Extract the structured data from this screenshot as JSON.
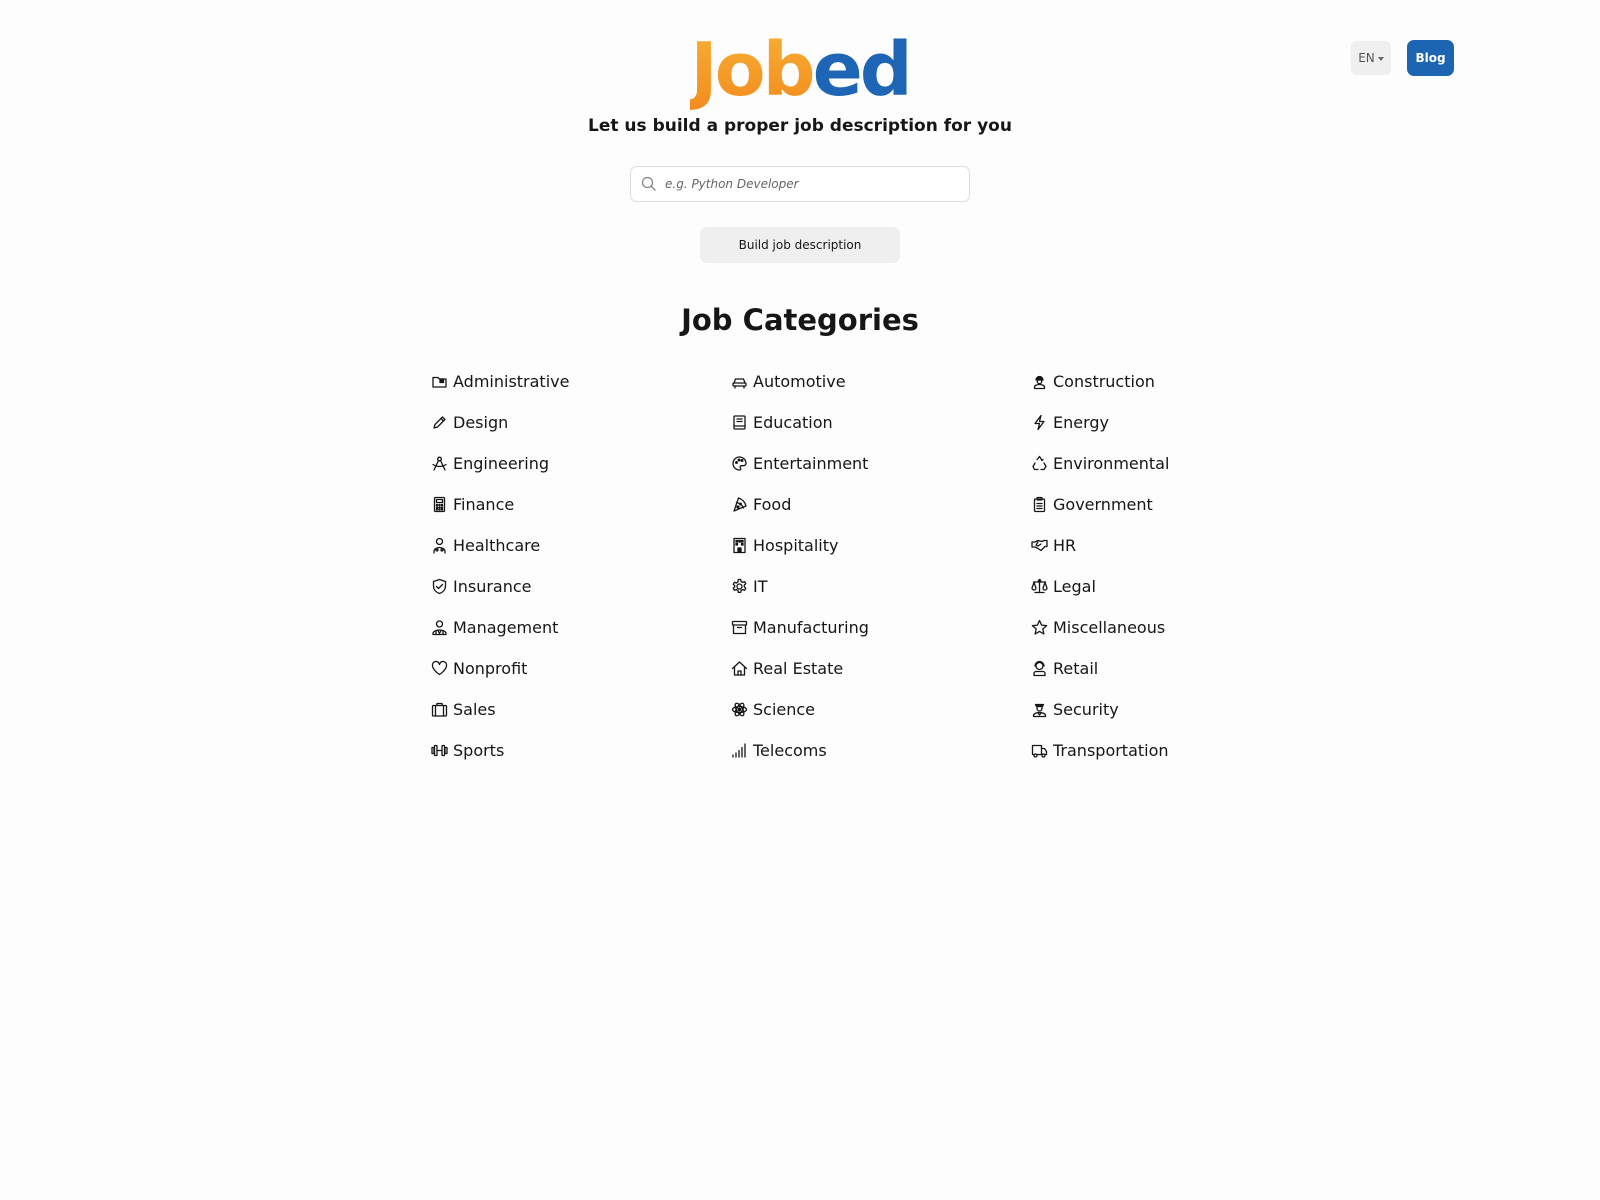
{
  "header": {
    "logo": {
      "part1": "Job",
      "part2": "ed",
      "colors": {
        "orange": "#f38a1e",
        "blue": "#1e65b5"
      }
    },
    "language_button": {
      "label": "EN",
      "icon": "caret-down-icon"
    },
    "blog_button": {
      "label": "Blog",
      "color": "#1d64b3"
    }
  },
  "hero": {
    "tagline": "Let us build a proper job description for you",
    "search": {
      "placeholder": "e.g. Python Developer",
      "value": "",
      "icon": "search-icon"
    },
    "build_button": {
      "label": "Build job description"
    }
  },
  "categories": {
    "title": "Job Categories",
    "items": [
      {
        "label": "Administrative",
        "icon": "folder-icon"
      },
      {
        "label": "Automotive",
        "icon": "car-icon"
      },
      {
        "label": "Construction",
        "icon": "worker-icon"
      },
      {
        "label": "Design",
        "icon": "pencil-icon"
      },
      {
        "label": "Education",
        "icon": "book-icon"
      },
      {
        "label": "Energy",
        "icon": "bolt-icon"
      },
      {
        "label": "Engineering",
        "icon": "compass-icon"
      },
      {
        "label": "Entertainment",
        "icon": "palette-icon"
      },
      {
        "label": "Environmental",
        "icon": "recycle-icon"
      },
      {
        "label": "Finance",
        "icon": "calculator-icon"
      },
      {
        "label": "Food",
        "icon": "pizza-icon"
      },
      {
        "label": "Government",
        "icon": "clipboard-icon"
      },
      {
        "label": "Healthcare",
        "icon": "doctor-icon"
      },
      {
        "label": "Hospitality",
        "icon": "hotel-icon"
      },
      {
        "label": "HR",
        "icon": "handshake-icon"
      },
      {
        "label": "Insurance",
        "icon": "shield-check-icon"
      },
      {
        "label": "IT",
        "icon": "gear-icon"
      },
      {
        "label": "Legal",
        "icon": "scale-icon"
      },
      {
        "label": "Management",
        "icon": "manager-icon"
      },
      {
        "label": "Manufacturing",
        "icon": "archive-box-icon"
      },
      {
        "label": "Miscellaneous",
        "icon": "star-icon"
      },
      {
        "label": "Nonprofit",
        "icon": "heart-icon"
      },
      {
        "label": "Real Estate",
        "icon": "house-icon"
      },
      {
        "label": "Retail",
        "icon": "cashier-icon"
      },
      {
        "label": "Sales",
        "icon": "briefcase-icon"
      },
      {
        "label": "Science",
        "icon": "atom-icon"
      },
      {
        "label": "Security",
        "icon": "guard-icon"
      },
      {
        "label": "Sports",
        "icon": "dumbbell-icon"
      },
      {
        "label": "Telecoms",
        "icon": "signal-icon"
      },
      {
        "label": "Transportation",
        "icon": "truck-icon"
      }
    ]
  }
}
